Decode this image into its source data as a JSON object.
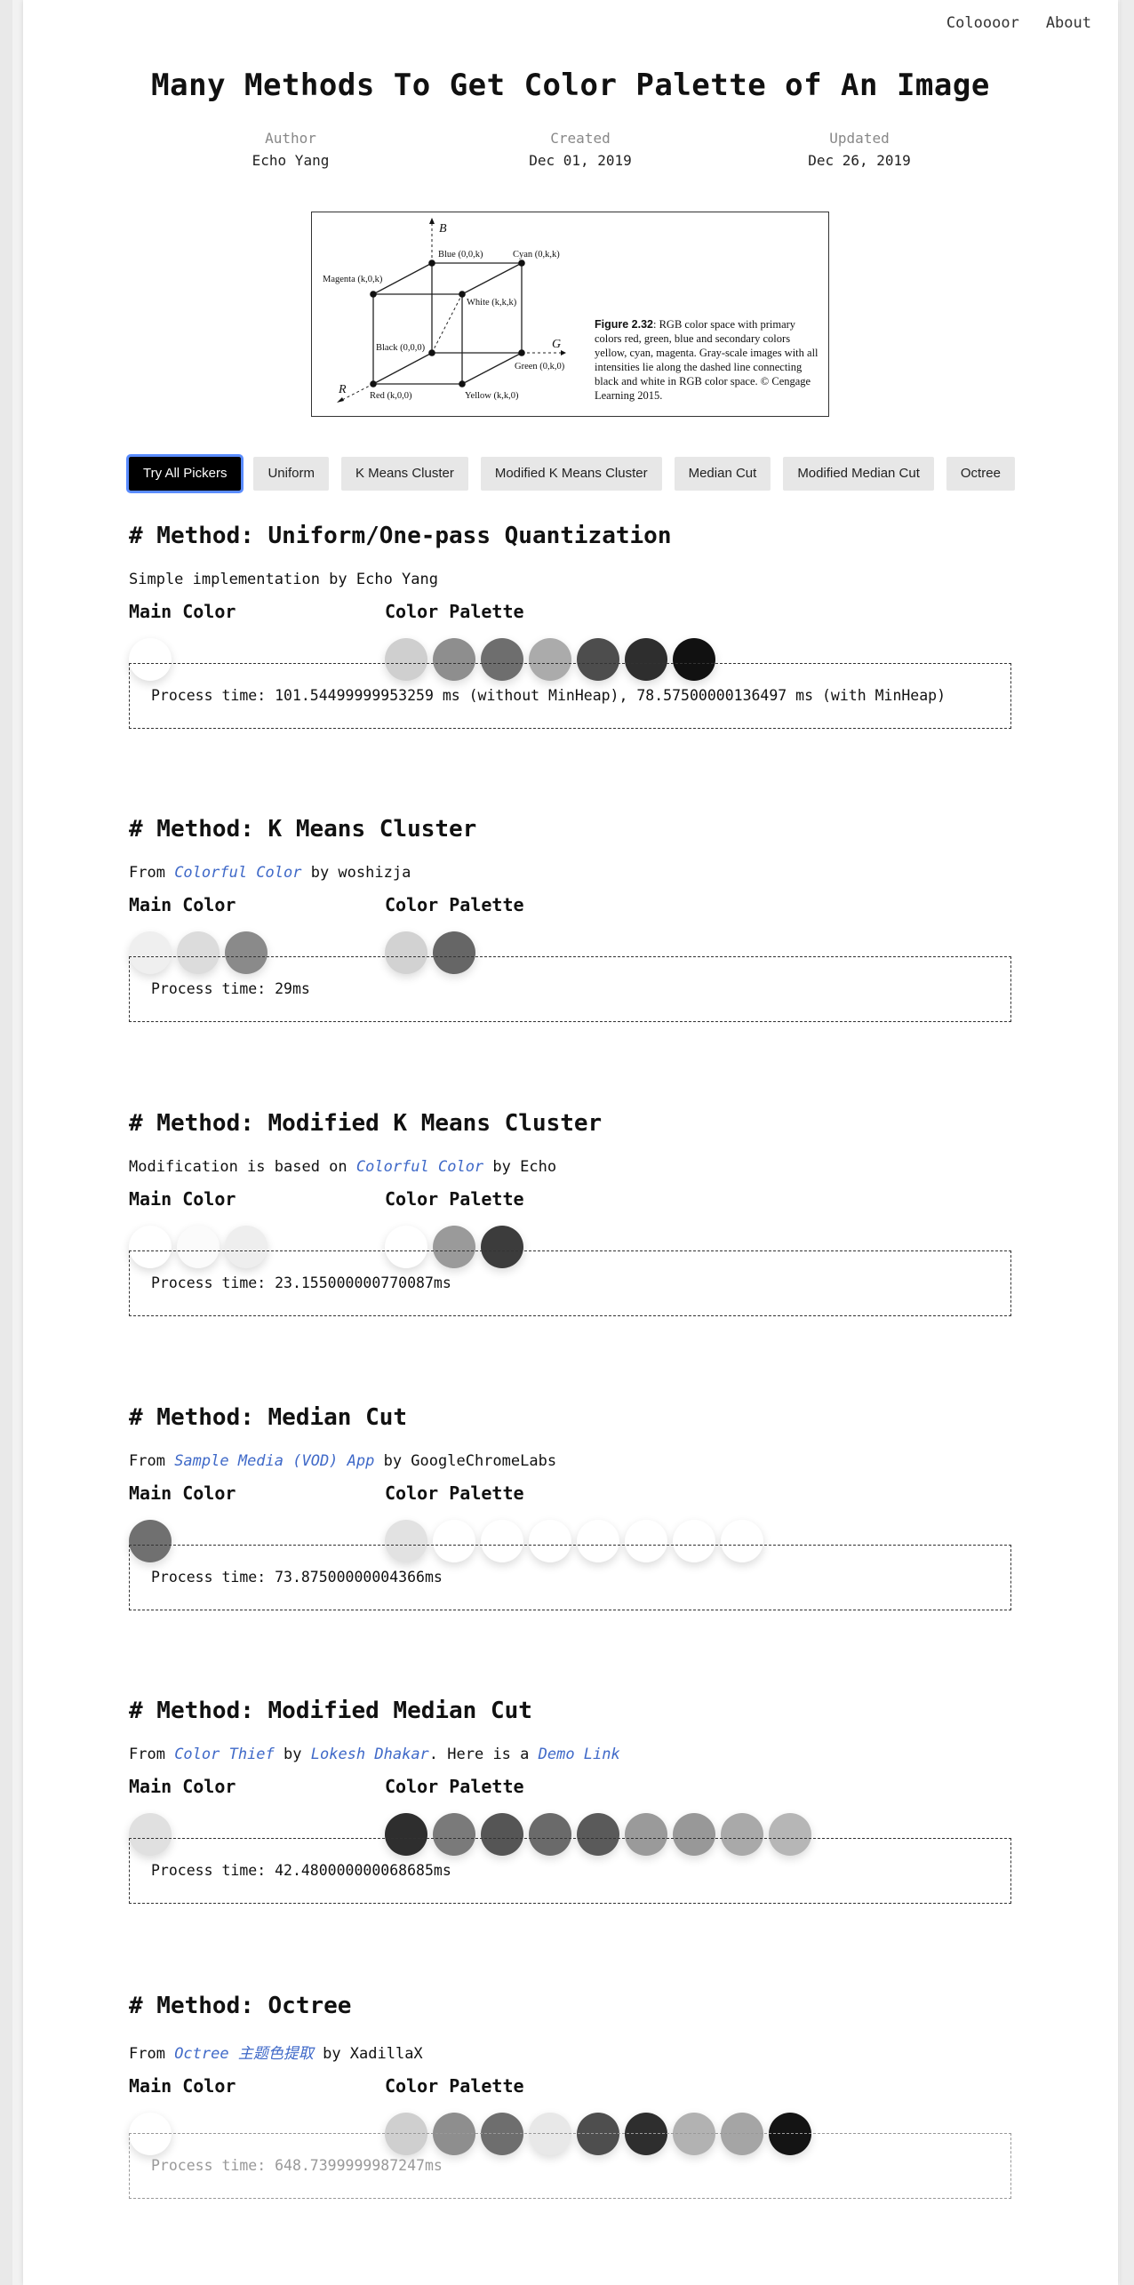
{
  "nav": {
    "links": [
      "Coloooor",
      "About"
    ]
  },
  "title": "Many Methods To Get Color Palette of An Image",
  "meta": {
    "author_label": "Author",
    "author": "Echo Yang",
    "created_label": "Created",
    "created": "Dec 01, 2019",
    "updated_label": "Updated",
    "updated": "Dec 26, 2019"
  },
  "figure": {
    "labels": {
      "b": "B",
      "g": "G",
      "r": "R",
      "blue": "Blue (0,0,k)",
      "cyan": "Cyan (0,k,k)",
      "magenta": "Magenta (k,0,k)",
      "white": "White (k,k,k)",
      "black": "Black (0,0,0)",
      "green": "Green (0,k,0)",
      "red": "Red (k,0,0)",
      "yellow": "Yellow (k,k,0)"
    },
    "caption_bold": "Figure 2.32",
    "caption_text": ": RGB color space with primary colors red, green, blue and secondary colors yellow, cyan, magenta. Gray-scale images with all intensities lie along the dashed line connecting black and white in RGB color space. © Cengage Learning 2015."
  },
  "tabs": [
    "Try All Pickers",
    "Uniform",
    "K Means Cluster",
    "Modified K Means Cluster",
    "Median Cut",
    "Modified Median Cut",
    "Octree"
  ],
  "active_tab": "Try All Pickers",
  "main_color_label": "Main Color",
  "palette_label": "Color Palette",
  "methods": [
    {
      "title": "# Method: Uniform/One-pass Quantization",
      "source": {
        "prefix": "Simple implementation by Echo Yang",
        "link1": "",
        "mid1": "",
        "link2": "",
        "mid2": "",
        "link3": ""
      },
      "main_colors": [
        "#ffffff"
      ],
      "palette": [
        "#cfcfcf",
        "#8e8e8e",
        "#6e6e6e",
        "#ababab",
        "#4d4d4d",
        "#2e2e2e",
        "#111111"
      ],
      "process": "Process time: 101.54499999953259 ms (without MinHeap), 78.57500000136497 ms (with MinHeap)"
    },
    {
      "title": "# Method: K Means Cluster",
      "source": {
        "prefix": "From ",
        "link1": "Colorful Color",
        "mid1": " by woshizja",
        "link2": "",
        "mid2": "",
        "link3": ""
      },
      "main_colors": [
        "#efefef",
        "#dcdcdc",
        "#8a8a8a"
      ],
      "palette": [
        "#d2d2d2",
        "#666666"
      ],
      "process": "Process time: 29ms"
    },
    {
      "title": "# Method: Modified K Means Cluster",
      "source": {
        "prefix": "Modification is based on ",
        "link1": "Colorful Color",
        "mid1": " by Echo",
        "link2": "",
        "mid2": "",
        "link3": ""
      },
      "main_colors": [
        "#ffffff",
        "#fbfbfb",
        "#eeeeee"
      ],
      "palette": [
        "#ffffff",
        "#9a9a9a",
        "#3c3c3c"
      ],
      "process": "Process time: 23.155000000770087ms"
    },
    {
      "title": "# Method: Median Cut",
      "source": {
        "prefix": "From ",
        "link1": "Sample Media (VOD) App",
        "mid1": " by GoogleChromeLabs",
        "link2": "",
        "mid2": "",
        "link3": ""
      },
      "main_colors": [
        "#707070"
      ],
      "palette": [
        "#e2e2e2",
        "#ffffff",
        "#ffffff",
        "#ffffff",
        "#ffffff",
        "#ffffff",
        "#ffffff",
        "#ffffff"
      ],
      "process": "Process time: 73.87500000004366ms"
    },
    {
      "title": "# Method: Modified Median Cut",
      "source": {
        "prefix": "From ",
        "link1": "Color Thief",
        "mid1": " by ",
        "link2": "Lokesh Dhakar",
        "mid2": ". Here is a ",
        "link3": "Demo Link"
      },
      "main_colors": [
        "#e0e0e0"
      ],
      "palette": [
        "#2e2e2e",
        "#7a7a7a",
        "#555555",
        "#6a6a6a",
        "#5a5a5a",
        "#9a9a9a",
        "#989898",
        "#a9a9a9",
        "#b6b6b6"
      ],
      "process": "Process time: 42.480000000068685ms"
    },
    {
      "title": "# Method: Octree",
      "source": {
        "prefix": "From ",
        "link1": "Octree 主题色提取",
        "mid1": " by XadillaX",
        "link2": "",
        "mid2": "",
        "link3": ""
      },
      "main_colors": [
        "#ffffff"
      ],
      "palette": [
        "#cfcfcf",
        "#8e8e8e",
        "#6e6e6e",
        "#e8e8e8",
        "#4e4e4e",
        "#2e2e2e",
        "#b2b2b2",
        "#a5a5a5",
        "#141414"
      ],
      "process": "Process time: 648.7399999987247ms"
    }
  ]
}
